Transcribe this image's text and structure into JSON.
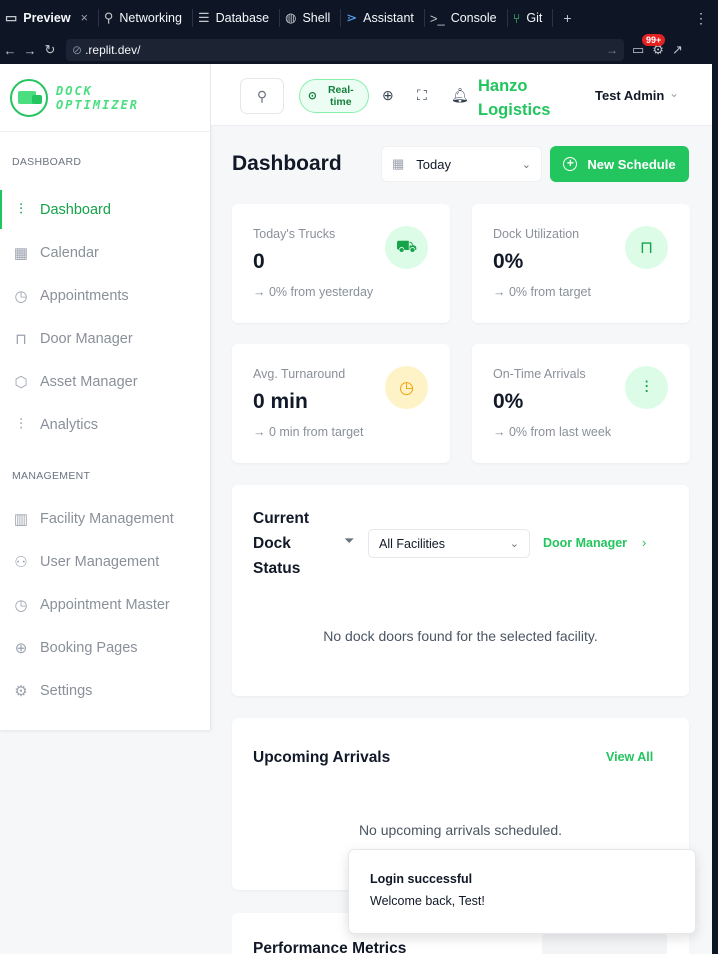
{
  "replit": {
    "tabs": [
      {
        "label": "Preview",
        "icon": "monitor-icon",
        "close": "×"
      },
      {
        "label": "Networking",
        "icon": "network-icon"
      },
      {
        "label": "Database",
        "icon": "database-icon"
      },
      {
        "label": "Shell",
        "icon": "shell-icon"
      },
      {
        "label": "Assistant",
        "icon": "assistant-icon"
      },
      {
        "label": "Console",
        "icon": "console-icon"
      },
      {
        "label": "Git",
        "icon": "git-icon"
      }
    ],
    "new_tab": "+",
    "more": "⋮",
    "url": ".replit.dev/",
    "notif_badge": "99+"
  },
  "app": {
    "logo_text": "DOCK OPTIMIZER",
    "logo_lines": [
      "DOCK",
      "OPTIMIZER"
    ],
    "sidebar": {
      "sections": [
        {
          "title": "DASHBOARD",
          "items": [
            {
              "label": "Dashboard",
              "icon": "bar-chart-icon",
              "active": true
            },
            {
              "label": "Calendar",
              "icon": "calendar-icon"
            },
            {
              "label": "Appointments",
              "icon": "calendar-clock-icon"
            },
            {
              "label": "Door Manager",
              "icon": "door-icon"
            },
            {
              "label": "Asset Manager",
              "icon": "package-icon"
            },
            {
              "label": "Analytics",
              "icon": "bar-chart-icon"
            }
          ]
        },
        {
          "title": "MANAGEMENT",
          "items": [
            {
              "label": "Facility Management",
              "icon": "building-icon"
            },
            {
              "label": "User Management",
              "icon": "users-icon"
            },
            {
              "label": "Appointment Master",
              "icon": "calendar-clock-icon"
            },
            {
              "label": "Booking Pages",
              "icon": "globe-icon"
            },
            {
              "label": "Settings",
              "icon": "gear-icon"
            }
          ]
        }
      ]
    },
    "header": {
      "realtime": "Real-time",
      "company": "Hanzo Logistics",
      "user": "Test Admin"
    },
    "main": {
      "title": "Dashboard",
      "date_filter": "Today",
      "new_schedule": "New Schedule",
      "stats": [
        {
          "label": "Today's Trucks",
          "value": "0",
          "delta": "→ 0% from yesterday",
          "icon": "truck-icon"
        },
        {
          "label": "Dock Utilization",
          "value": "0%",
          "delta": "→ 0% from target",
          "icon": "door-icon"
        },
        {
          "label": "Avg. Turnaround",
          "value": "0 min",
          "delta": "→ 0 min from target",
          "icon": "clock-icon"
        },
        {
          "label": "On-Time Arrivals",
          "value": "0%",
          "delta": "→ 0% from last week",
          "icon": "bar-chart-icon"
        }
      ],
      "dock_status": {
        "title": "Current Dock Status",
        "title_lines": [
          "Current",
          "Dock",
          "Status"
        ],
        "facility_filter": "All Facilities",
        "door_manager_link": "Door Manager",
        "empty": "No dock doors found for the selected facility."
      },
      "arrivals": {
        "title": "Upcoming Arrivals",
        "view_all": "View All",
        "empty": "No upcoming arrivals scheduled."
      },
      "performance": {
        "title": "Performance Metrics"
      }
    },
    "toast": {
      "title": "Login successful",
      "message": "Welcome back, Test!"
    }
  }
}
